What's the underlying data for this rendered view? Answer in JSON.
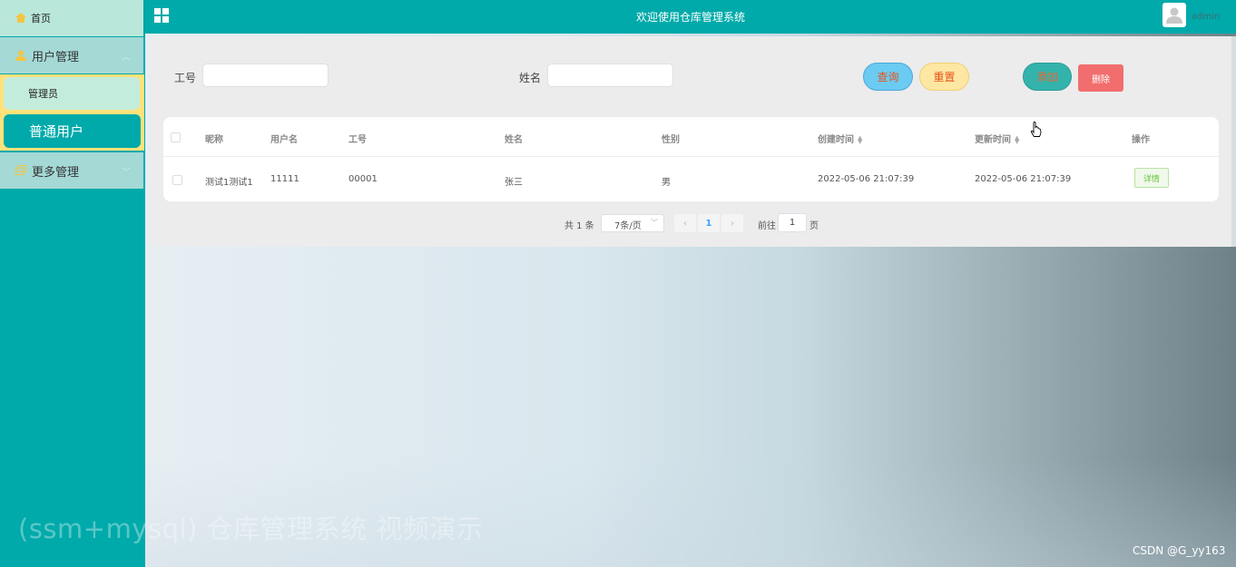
{
  "header": {
    "title": "欢迎使用仓库管理系统",
    "username": "admin"
  },
  "sidebar": {
    "home": "首页",
    "user_mgmt": "用户管理",
    "sub_admin": "管理员",
    "sub_user": "普通用户",
    "more_mgmt": "更多管理"
  },
  "search": {
    "emp_no_label": "工号",
    "emp_no_value": "",
    "name_label": "姓名",
    "name_value": "",
    "query_btn": "查询",
    "reset_btn": "重置",
    "add_btn": "添加",
    "delete_btn": "删除"
  },
  "table": {
    "columns": [
      "昵称",
      "用户名",
      "工号",
      "姓名",
      "性别",
      "创建时间",
      "更新时间",
      "操作"
    ],
    "rows": [
      {
        "nickname": "测试1测试1",
        "username": "11111",
        "emp_no": "00001",
        "name": "张三",
        "gender": "男",
        "created": "2022-05-06 21:07:39",
        "updated": "2022-05-06 21:07:39",
        "action": "详情"
      }
    ]
  },
  "pagination": {
    "total_text": "共 1 条",
    "page_size": "7条/页",
    "current_page": "1",
    "goto_label": "前往",
    "goto_value": "1",
    "page_suffix": "页"
  },
  "overlay": {
    "watermark": "(ssm+mysql) 仓库管理系统 视频演示",
    "credit": "CSDN @G_yy163"
  }
}
